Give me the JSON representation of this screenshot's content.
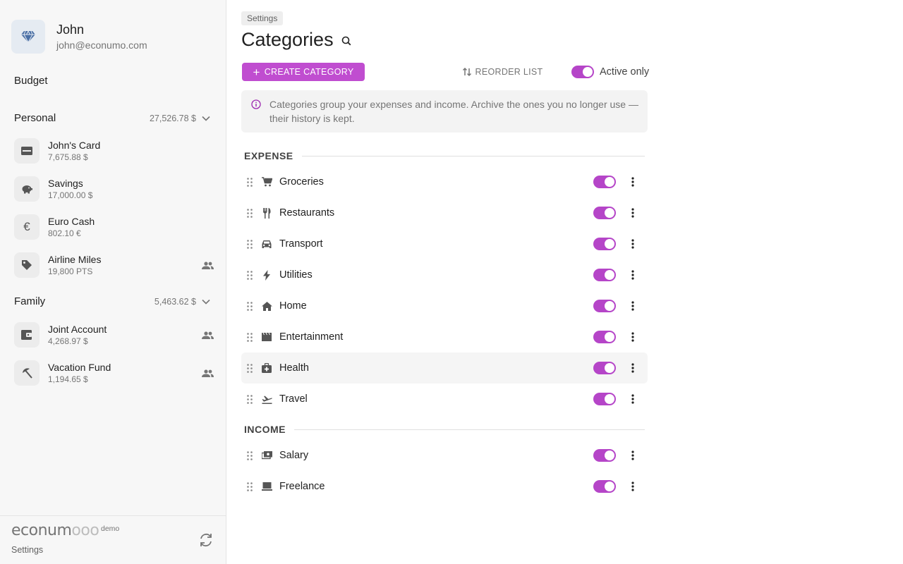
{
  "user": {
    "name": "John",
    "email": "john@econumo.com"
  },
  "sidebar": {
    "budget_label": "Budget",
    "folders": [
      {
        "name": "Personal",
        "total": "27,526.78 $",
        "accounts": [
          {
            "name": "John's Card",
            "balance": "7,675.88 $",
            "icon": "credit-card-icon"
          },
          {
            "name": "Savings",
            "balance": "17,000.00 $",
            "icon": "piggy-bank-icon"
          },
          {
            "name": "Euro Cash",
            "balance": "802.10 €",
            "icon": "euro-icon"
          },
          {
            "name": "Airline Miles",
            "balance": "19,800 PTS",
            "icon": "tag-icon",
            "shared": true
          }
        ]
      },
      {
        "name": "Family",
        "total": "5,463.62 $",
        "accounts": [
          {
            "name": "Joint Account",
            "balance": "4,268.97 $",
            "icon": "wallet-icon",
            "shared": true
          },
          {
            "name": "Vacation Fund",
            "balance": "1,194.65 $",
            "icon": "beach-umbrella-icon",
            "shared": true
          }
        ]
      }
    ],
    "footer": {
      "logo_text": "econum",
      "logo_circles": "ooo",
      "demo_label": "demo",
      "settings_label": "Settings"
    }
  },
  "main": {
    "breadcrumb": "Settings",
    "title": "Categories",
    "create_label": "CREATE CATEGORY",
    "reorder_label": "REORDER LIST",
    "active_only_label": "Active only",
    "active_only_on": true,
    "info_text": "Categories group your expenses and income. Archive the ones you no longer use — their history is kept.",
    "sections": [
      {
        "title": "EXPENSE",
        "items": [
          {
            "name": "Groceries",
            "icon": "shopping-cart-icon",
            "active": true
          },
          {
            "name": "Restaurants",
            "icon": "fork-knife-icon",
            "active": true
          },
          {
            "name": "Transport",
            "icon": "car-icon",
            "active": true
          },
          {
            "name": "Utilities",
            "icon": "lightning-icon",
            "active": true
          },
          {
            "name": "Home",
            "icon": "house-icon",
            "active": true
          },
          {
            "name": "Entertainment",
            "icon": "film-clapper-icon",
            "active": true
          },
          {
            "name": "Health",
            "icon": "medical-bag-icon",
            "active": true
          },
          {
            "name": "Travel",
            "icon": "airplane-takeoff-icon",
            "active": true
          }
        ]
      },
      {
        "title": "INCOME",
        "items": [
          {
            "name": "Salary",
            "icon": "cash-icon",
            "active": true
          },
          {
            "name": "Freelance",
            "icon": "laptop-icon",
            "active": true
          }
        ]
      }
    ]
  },
  "colors": {
    "accent": "#c04dd0",
    "toggle_on": "#b545c8",
    "sidebar_bg": "#f7f7f7",
    "avatar_bg": "#e5ebf2",
    "diamond": "#4a6fa5"
  }
}
